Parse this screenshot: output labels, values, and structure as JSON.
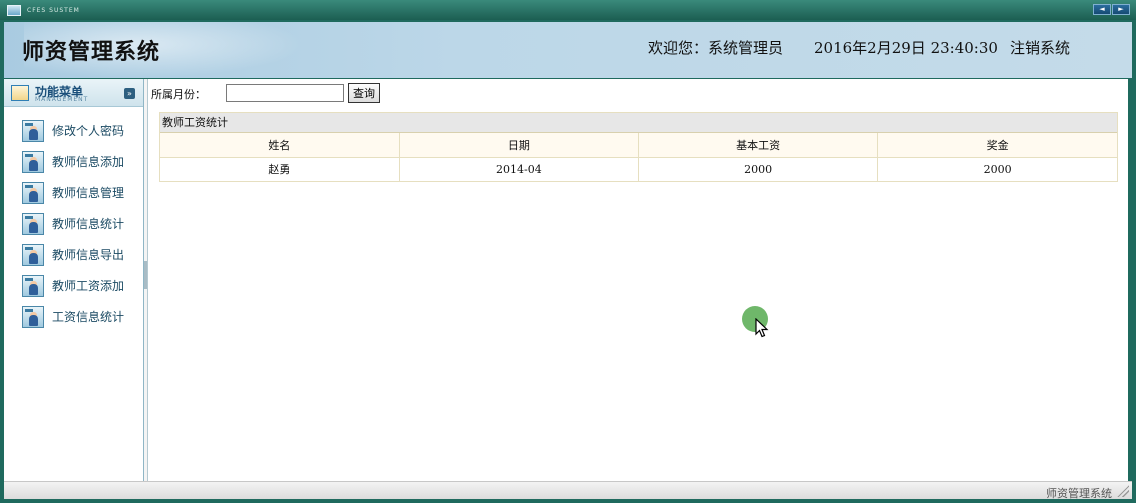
{
  "titlebar": {
    "system_label": "CFES SUSTEM",
    "prev_btn": "◄",
    "next_btn": "►"
  },
  "header": {
    "title": "师资管理系统",
    "welcome": "欢迎您：系统管理员",
    "datetime": "2016年2月29日  23:40:30",
    "logout": "注销系统"
  },
  "sidebar": {
    "menu_title": "功能菜单",
    "menu_subtitle": "MANAGEMENT",
    "collapse_glyph": "»",
    "items": [
      {
        "label": "修改个人密码"
      },
      {
        "label": "教师信息添加"
      },
      {
        "label": "教师信息管理"
      },
      {
        "label": "教师信息统计"
      },
      {
        "label": "教师信息导出"
      },
      {
        "label": "教师工资添加"
      },
      {
        "label": "工资信息统计"
      }
    ]
  },
  "search": {
    "label": "所属月份：",
    "value": "",
    "button": "查询"
  },
  "stats": {
    "title": "教师工资统计",
    "columns": [
      "姓名",
      "日期",
      "基本工资",
      "奖金"
    ],
    "rows": [
      {
        "name": "赵勇",
        "date": "2014-04",
        "base": "2000",
        "bonus": "2000"
      }
    ]
  },
  "footer": {
    "text": "师资管理系统"
  },
  "colors": {
    "frame": "#1f6a5e",
    "header_bg": "#bcd7e8",
    "menu_text": "#1b4a63",
    "cursor_highlight": "#6fb76a"
  }
}
